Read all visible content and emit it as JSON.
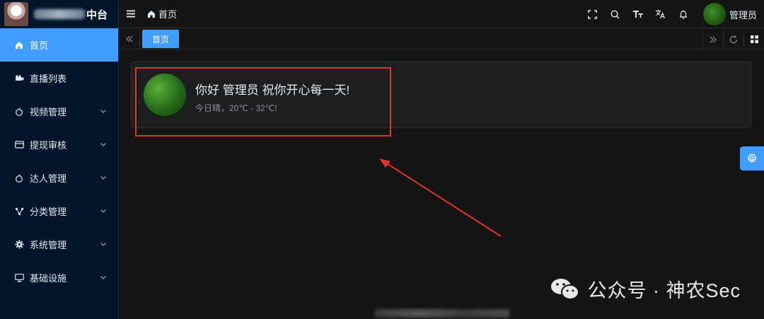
{
  "brand": {
    "title": "中台"
  },
  "sidebar": {
    "items": [
      {
        "label": "首页",
        "icon": "home-icon",
        "active": true,
        "has_children": false
      },
      {
        "label": "直播列表",
        "icon": "camera-icon",
        "active": false,
        "has_children": false
      },
      {
        "label": "视频管理",
        "icon": "apple-icon",
        "active": false,
        "has_children": true
      },
      {
        "label": "提现审核",
        "icon": "card-icon",
        "active": false,
        "has_children": true
      },
      {
        "label": "达人管理",
        "icon": "apple-icon",
        "active": false,
        "has_children": true
      },
      {
        "label": "分类管理",
        "icon": "share-icon",
        "active": false,
        "has_children": true
      },
      {
        "label": "系统管理",
        "icon": "gear-icon",
        "active": false,
        "has_children": true
      },
      {
        "label": "基础设施",
        "icon": "monitor-icon",
        "active": false,
        "has_children": true
      }
    ]
  },
  "header": {
    "breadcrumb": "首页",
    "user_name": "管理员",
    "icons": [
      "fullscreen-icon",
      "search-icon",
      "font-size-icon",
      "translate-icon",
      "bell-icon"
    ]
  },
  "tabs": {
    "items": [
      {
        "label": "首页",
        "active": true
      }
    ]
  },
  "welcome": {
    "title": "你好 管理员 祝你开心每一天!",
    "subtitle": "今日晴，20℃ - 32℃!"
  },
  "watermark": {
    "text": "公众号 · 神农Sec"
  },
  "colors": {
    "accent": "#409eff",
    "sidebar_bg": "#001529",
    "page_bg": "#141414",
    "highlight": "#e0322e"
  }
}
